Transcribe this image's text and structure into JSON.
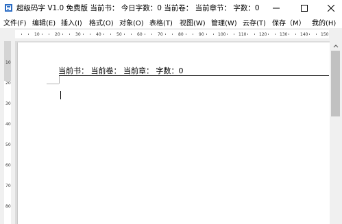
{
  "titlebar": {
    "title": "超级码字 V1.0 免费版  当前书：  今日字数：0  当前卷：    当前章节：  字数：0",
    "icons": [
      "app-icon",
      "minimize-icon",
      "maximize-icon",
      "close-icon"
    ]
  },
  "menu": {
    "items": [
      "文件(F)",
      "编辑(E)",
      "插入(I)",
      "格式(O)",
      "对象(O)",
      "表格(T)",
      "视图(W)",
      "管理(W)",
      "云存(T)",
      "保存（M）",
      "我的(H)"
    ]
  },
  "ruler": {
    "h_labels": [
      "10",
      "20",
      "30",
      "40",
      "50",
      "60",
      "70",
      "80",
      "90",
      "100",
      "110",
      "120",
      "130",
      "140",
      "150"
    ],
    "v_labels": [
      "10",
      "20",
      "30",
      "40",
      "50",
      "60",
      "70",
      "80"
    ]
  },
  "document": {
    "header": "当前书：  当前卷：  当前章：  字数：0"
  }
}
